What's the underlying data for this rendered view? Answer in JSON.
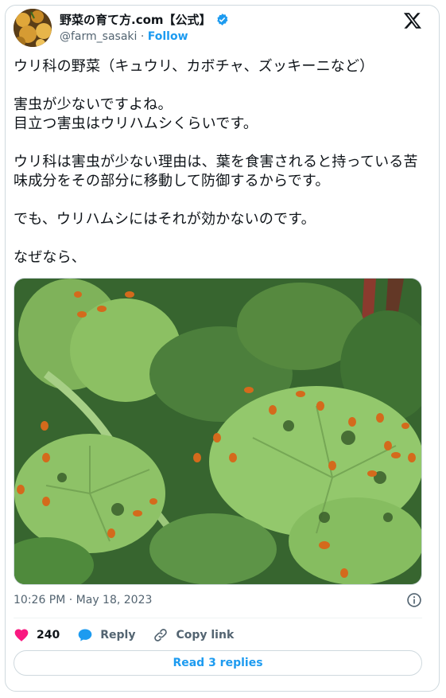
{
  "author": {
    "display_name": "野菜の育て方.com【公式】",
    "handle": "@farm_sasaki",
    "separator": "·",
    "follow_label": "Follow"
  },
  "tweet": {
    "text": "ウリ科の野菜（キュウリ、カボチャ、ズッキーニなど）\n\n害虫が少ないですよね。\n目立つ害虫はウリハムシくらいです。\n\nウリ科は害虫が少ない理由は、葉を食害されると持っている苦味成分をその部分に移動して防御するからです。\n\nでも、ウリハムシにはそれが効かないのです。\n\nなぜなら、",
    "timestamp": "10:26 PM · May 18, 2023"
  },
  "actions": {
    "like_count": "240",
    "reply_label": "Reply",
    "copy_link_label": "Copy link"
  },
  "read_replies_label": "Read 3 replies",
  "colors": {
    "accent": "#1d9bf0",
    "like": "#f91880",
    "muted": "#536471",
    "border": "#cfd9de"
  },
  "icons": [
    "verified-badge-icon",
    "x-logo-icon",
    "info-icon",
    "heart-icon",
    "reply-bubble-icon",
    "link-icon"
  ]
}
